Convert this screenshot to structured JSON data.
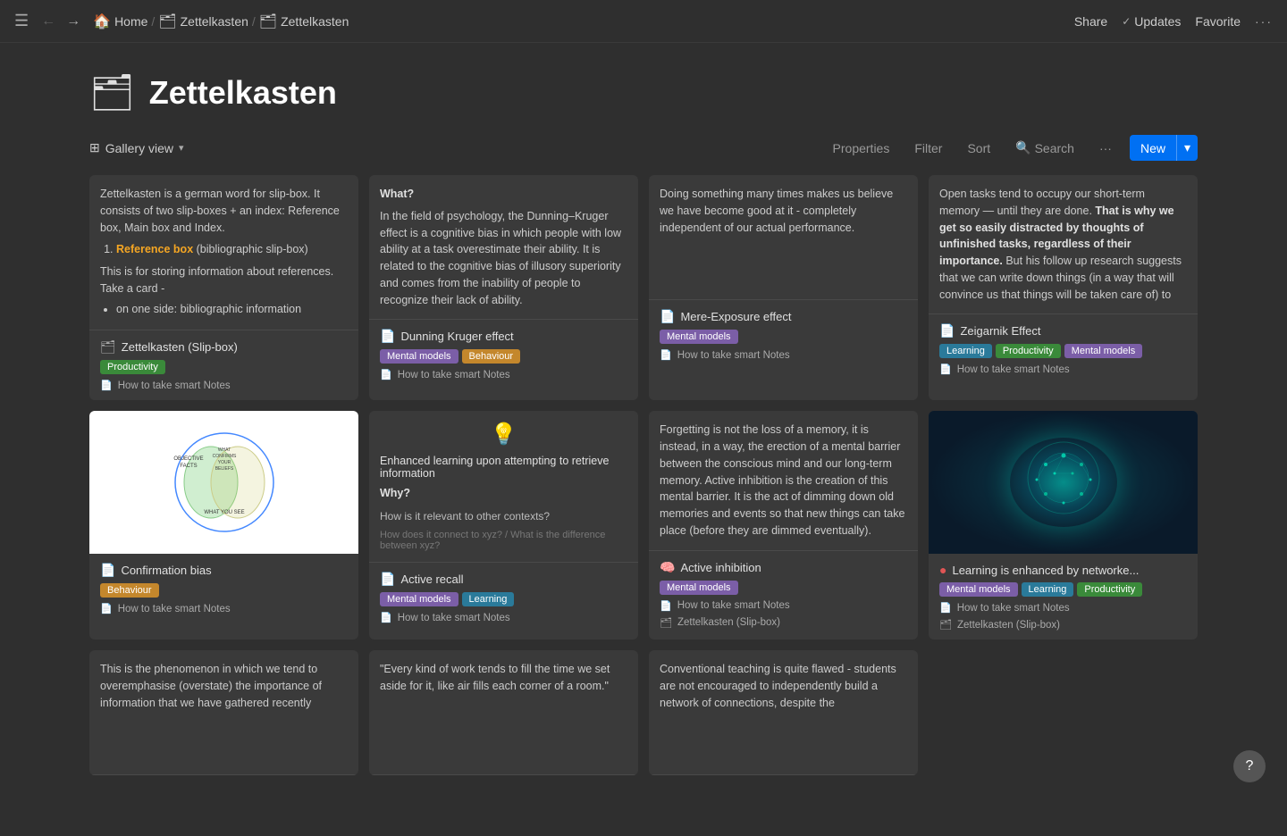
{
  "topbar": {
    "nav_left": "☰",
    "back_arrow": "←",
    "forward_arrow": "→",
    "breadcrumbs": [
      {
        "icon": "🏠",
        "label": "Home"
      },
      {
        "icon": "🗂",
        "label": "Zettelkasten"
      },
      {
        "icon": "🗂",
        "label": "Zettelkasten"
      }
    ],
    "share_label": "Share",
    "updates_check": "✓",
    "updates_label": "Updates",
    "favorite_label": "Favorite",
    "more_dots": "···"
  },
  "page": {
    "icon": "🗂",
    "title": "Zettelkasten"
  },
  "toolbar": {
    "view_icon": "⊞",
    "view_label": "Gallery view",
    "properties_label": "Properties",
    "filter_label": "Filter",
    "sort_label": "Sort",
    "search_icon": "🔍",
    "search_label": "Search",
    "more_label": "···",
    "new_label": "New",
    "new_arrow": "▾"
  },
  "cards": [
    {
      "id": "card1",
      "preview_text": "Zettelkasten is a german word for slip-box. It consists of two slip-boxes + an index: Reference box, Main box and Index.",
      "list_item": "Reference box (bibliographic slip-box)",
      "list_item_style": "highlight",
      "extra_text": "This is for storing information about references. Take a card -",
      "bullet": "on one side: bibliographic information",
      "title_icon": "🗂",
      "title": "Zettelkasten (Slip-box)",
      "tags": [
        {
          "label": "Productivity",
          "class": "tag-productivity"
        }
      ],
      "sources": [
        {
          "icon": "📄",
          "label": "How to take smart Notes"
        }
      ]
    },
    {
      "id": "card2",
      "preview_heading": "What?",
      "preview_text": "In the field of psychology, the Dunning–Kruger effect is a cognitive bias in which people with low ability at a task overestimate their ability. It is related to the cognitive bias of illusory superiority and comes from the inability of people to recognize their lack of ability.",
      "title_icon": "📄",
      "title": "Dunning Kruger effect",
      "tags": [
        {
          "label": "Mental models",
          "class": "tag-mental-models"
        },
        {
          "label": "Behaviour",
          "class": "tag-behaviour"
        }
      ],
      "sources": [
        {
          "icon": "📄",
          "label": "How to take smart Notes"
        }
      ]
    },
    {
      "id": "card3",
      "preview_text": "Doing something many times makes us believe we have become good at it - completely independent of our actual performance.",
      "title_icon": "📄",
      "title": "Mere-Exposure effect",
      "tags": [
        {
          "label": "Mental models",
          "class": "tag-mental-models"
        }
      ],
      "sources": [
        {
          "icon": "📄",
          "label": "How to take smart Notes"
        }
      ]
    },
    {
      "id": "card4",
      "preview_text": "Open tasks tend to occupy our short-term memory — until they are done.",
      "preview_bold": "That is why we get so easily distracted by thoughts of unfinished tasks, regardless of their importance.",
      "preview_extra": "But his follow up research suggests that we can write down things (in a way that will convince us that things will be taken care of) to",
      "title_icon": "📄",
      "title": "Zeigarnik Effect",
      "tags": [
        {
          "label": "Learning",
          "class": "tag-learning"
        },
        {
          "label": "Productivity",
          "class": "tag-productivity"
        },
        {
          "label": "Mental models",
          "class": "tag-mental-models"
        }
      ],
      "sources": [
        {
          "icon": "📄",
          "label": "How to take smart Notes"
        }
      ]
    },
    {
      "id": "card5",
      "has_venn": true,
      "title_icon": "📄",
      "title": "Confirmation bias",
      "tags": [
        {
          "label": "Behaviour",
          "class": "tag-behaviour"
        }
      ],
      "sources": [
        {
          "icon": "📄",
          "label": "How to take smart Notes"
        }
      ]
    },
    {
      "id": "card6",
      "has_recall": true,
      "recall_heading": "Enhanced learning upon attempting to retrieve information",
      "recall_subheading": "Why?",
      "recall_q": "How is it relevant to other contexts?",
      "recall_placeholder": "How does it connect to xyz? / What is the difference between xyz?",
      "title_icon": "📄",
      "title": "Active recall",
      "tags": [
        {
          "label": "Mental models",
          "class": "tag-mental-models"
        },
        {
          "label": "Learning",
          "class": "tag-learning"
        }
      ],
      "sources": [
        {
          "icon": "📄",
          "label": "How to take smart Notes"
        }
      ]
    },
    {
      "id": "card7",
      "preview_text": "Forgetting is not the loss of a memory, it is instead, in a way, the erection of a mental barrier between the conscious mind and our long-term memory. Active inhibition is the creation of this mental barrier. It is the act of dimming down old memories and events so that new things can take place (before they are dimmed eventually).",
      "title_icon": "🧠",
      "title": "Active inhibition",
      "tags": [
        {
          "label": "Mental models",
          "class": "tag-mental-models"
        }
      ],
      "sources": [
        {
          "icon": "📄",
          "label": "How to take smart Notes"
        },
        {
          "icon": "🗂",
          "label": "Zettelkasten (Slip-box)"
        }
      ]
    },
    {
      "id": "card8",
      "has_brain": true,
      "title_icon": "🔴",
      "title": "Learning is enhanced by networke...",
      "tags": [
        {
          "label": "Mental models",
          "class": "tag-mental-models"
        },
        {
          "label": "Learning",
          "class": "tag-learning"
        },
        {
          "label": "Productivity",
          "class": "tag-productivity"
        }
      ],
      "sources": [
        {
          "icon": "📄",
          "label": "How to take smart Notes"
        },
        {
          "icon": "🗂",
          "label": "Zettelkasten (Slip-box)"
        }
      ]
    },
    {
      "id": "card9",
      "preview_text": "This is the phenomenon in which we tend to overemphasise (overstate) the importance of information that we have gathered recently",
      "title_icon": "",
      "title": "",
      "tags": [],
      "sources": []
    },
    {
      "id": "card10",
      "preview_quote": "\"Every kind of work tends to fill the time we set aside for it, like air fills each corner of a room.\"",
      "title_icon": "",
      "title": "",
      "tags": [],
      "sources": []
    },
    {
      "id": "card11",
      "preview_text": "Conventional teaching is quite flawed - students are not encouraged to independently build a network of connections, despite the",
      "title_icon": "",
      "title": "",
      "tags": [],
      "sources": []
    }
  ],
  "help": {
    "label": "?"
  }
}
